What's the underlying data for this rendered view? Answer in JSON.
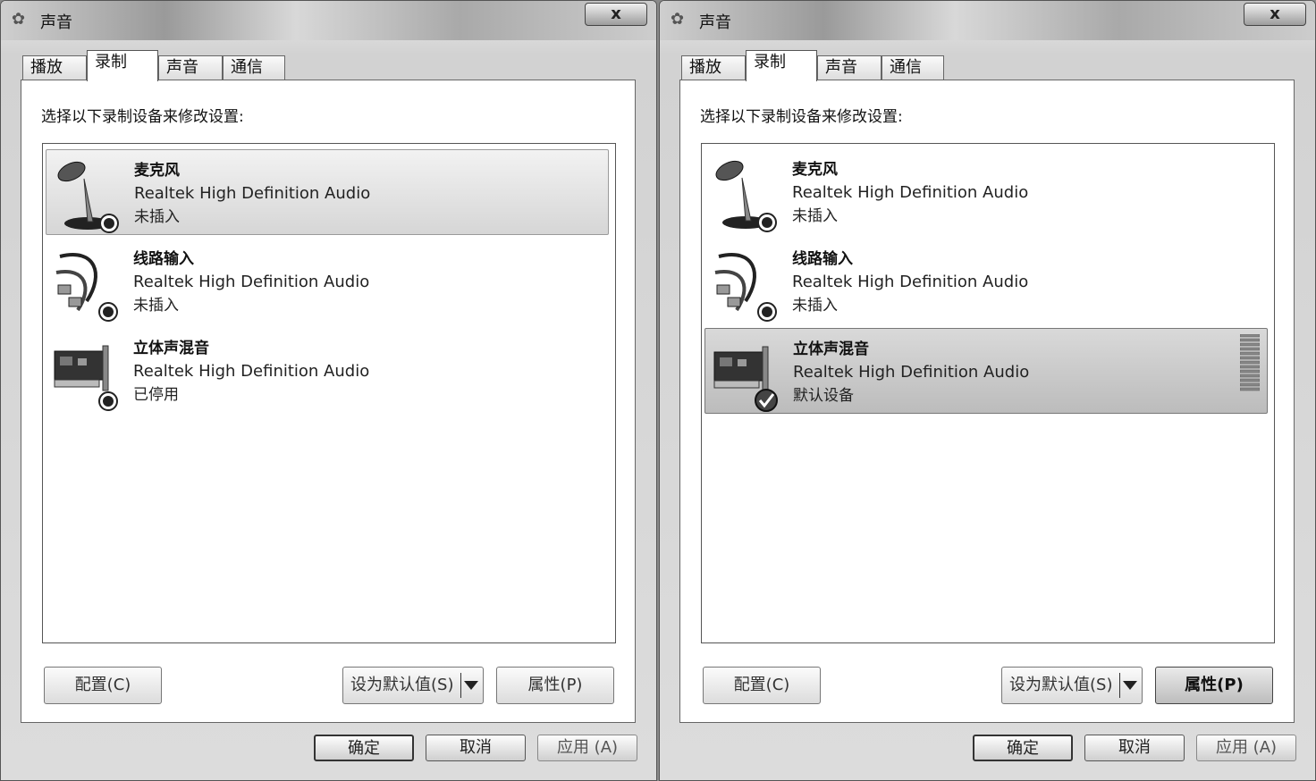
{
  "windows": [
    {
      "title": "声音",
      "close_label": "x",
      "tabs": [
        "播放",
        "录制",
        "声音",
        "通信"
      ],
      "active_tab": 1,
      "instruction": "选择以下录制设备来修改设置:",
      "devices": [
        {
          "name": "麦克风",
          "driver": "Realtek High Definition Audio",
          "status": "未插入",
          "icon": "microphone-icon",
          "badge": "disconnected-badge-icon",
          "selected": true
        },
        {
          "name": "线路输入",
          "driver": "Realtek High Definition Audio",
          "status": "未插入",
          "icon": "line-in-cable-icon",
          "badge": "disconnected-badge-icon",
          "selected": false
        },
        {
          "name": "立体声混音",
          "driver": "Realtek High Definition Audio",
          "status": "已停用",
          "icon": "sound-card-icon",
          "badge": "disabled-badge-icon",
          "selected": false
        }
      ],
      "configure_label": "配置(C)",
      "set_default_label": "设为默认值(S)",
      "properties_label": "属性(P)",
      "ok_label": "确定",
      "cancel_label": "取消",
      "apply_label": "应用 (A)"
    },
    {
      "title": "声音",
      "close_label": "x",
      "tabs": [
        "播放",
        "录制",
        "声音",
        "通信"
      ],
      "active_tab": 1,
      "instruction": "选择以下录制设备来修改设置:",
      "devices": [
        {
          "name": "麦克风",
          "driver": "Realtek High Definition Audio",
          "status": "未插入",
          "icon": "microphone-icon",
          "badge": "disconnected-badge-icon",
          "selected": false
        },
        {
          "name": "线路输入",
          "driver": "Realtek High Definition Audio",
          "status": "未插入",
          "icon": "line-in-cable-icon",
          "badge": "disconnected-badge-icon",
          "selected": false
        },
        {
          "name": "立体声混音",
          "driver": "Realtek High Definition Audio",
          "status": "默认设备",
          "icon": "sound-card-icon",
          "badge": "default-check-badge-icon",
          "selected": true
        }
      ],
      "configure_label": "配置(C)",
      "set_default_label": "设为默认值(S)",
      "properties_label": "属性(P)",
      "ok_label": "确定",
      "cancel_label": "取消",
      "apply_label": "应用 (A)"
    }
  ],
  "colors": {
    "window_bg": "#d8d8d8",
    "panel_bg": "#ffffff",
    "selection": "#d6d6d6"
  }
}
